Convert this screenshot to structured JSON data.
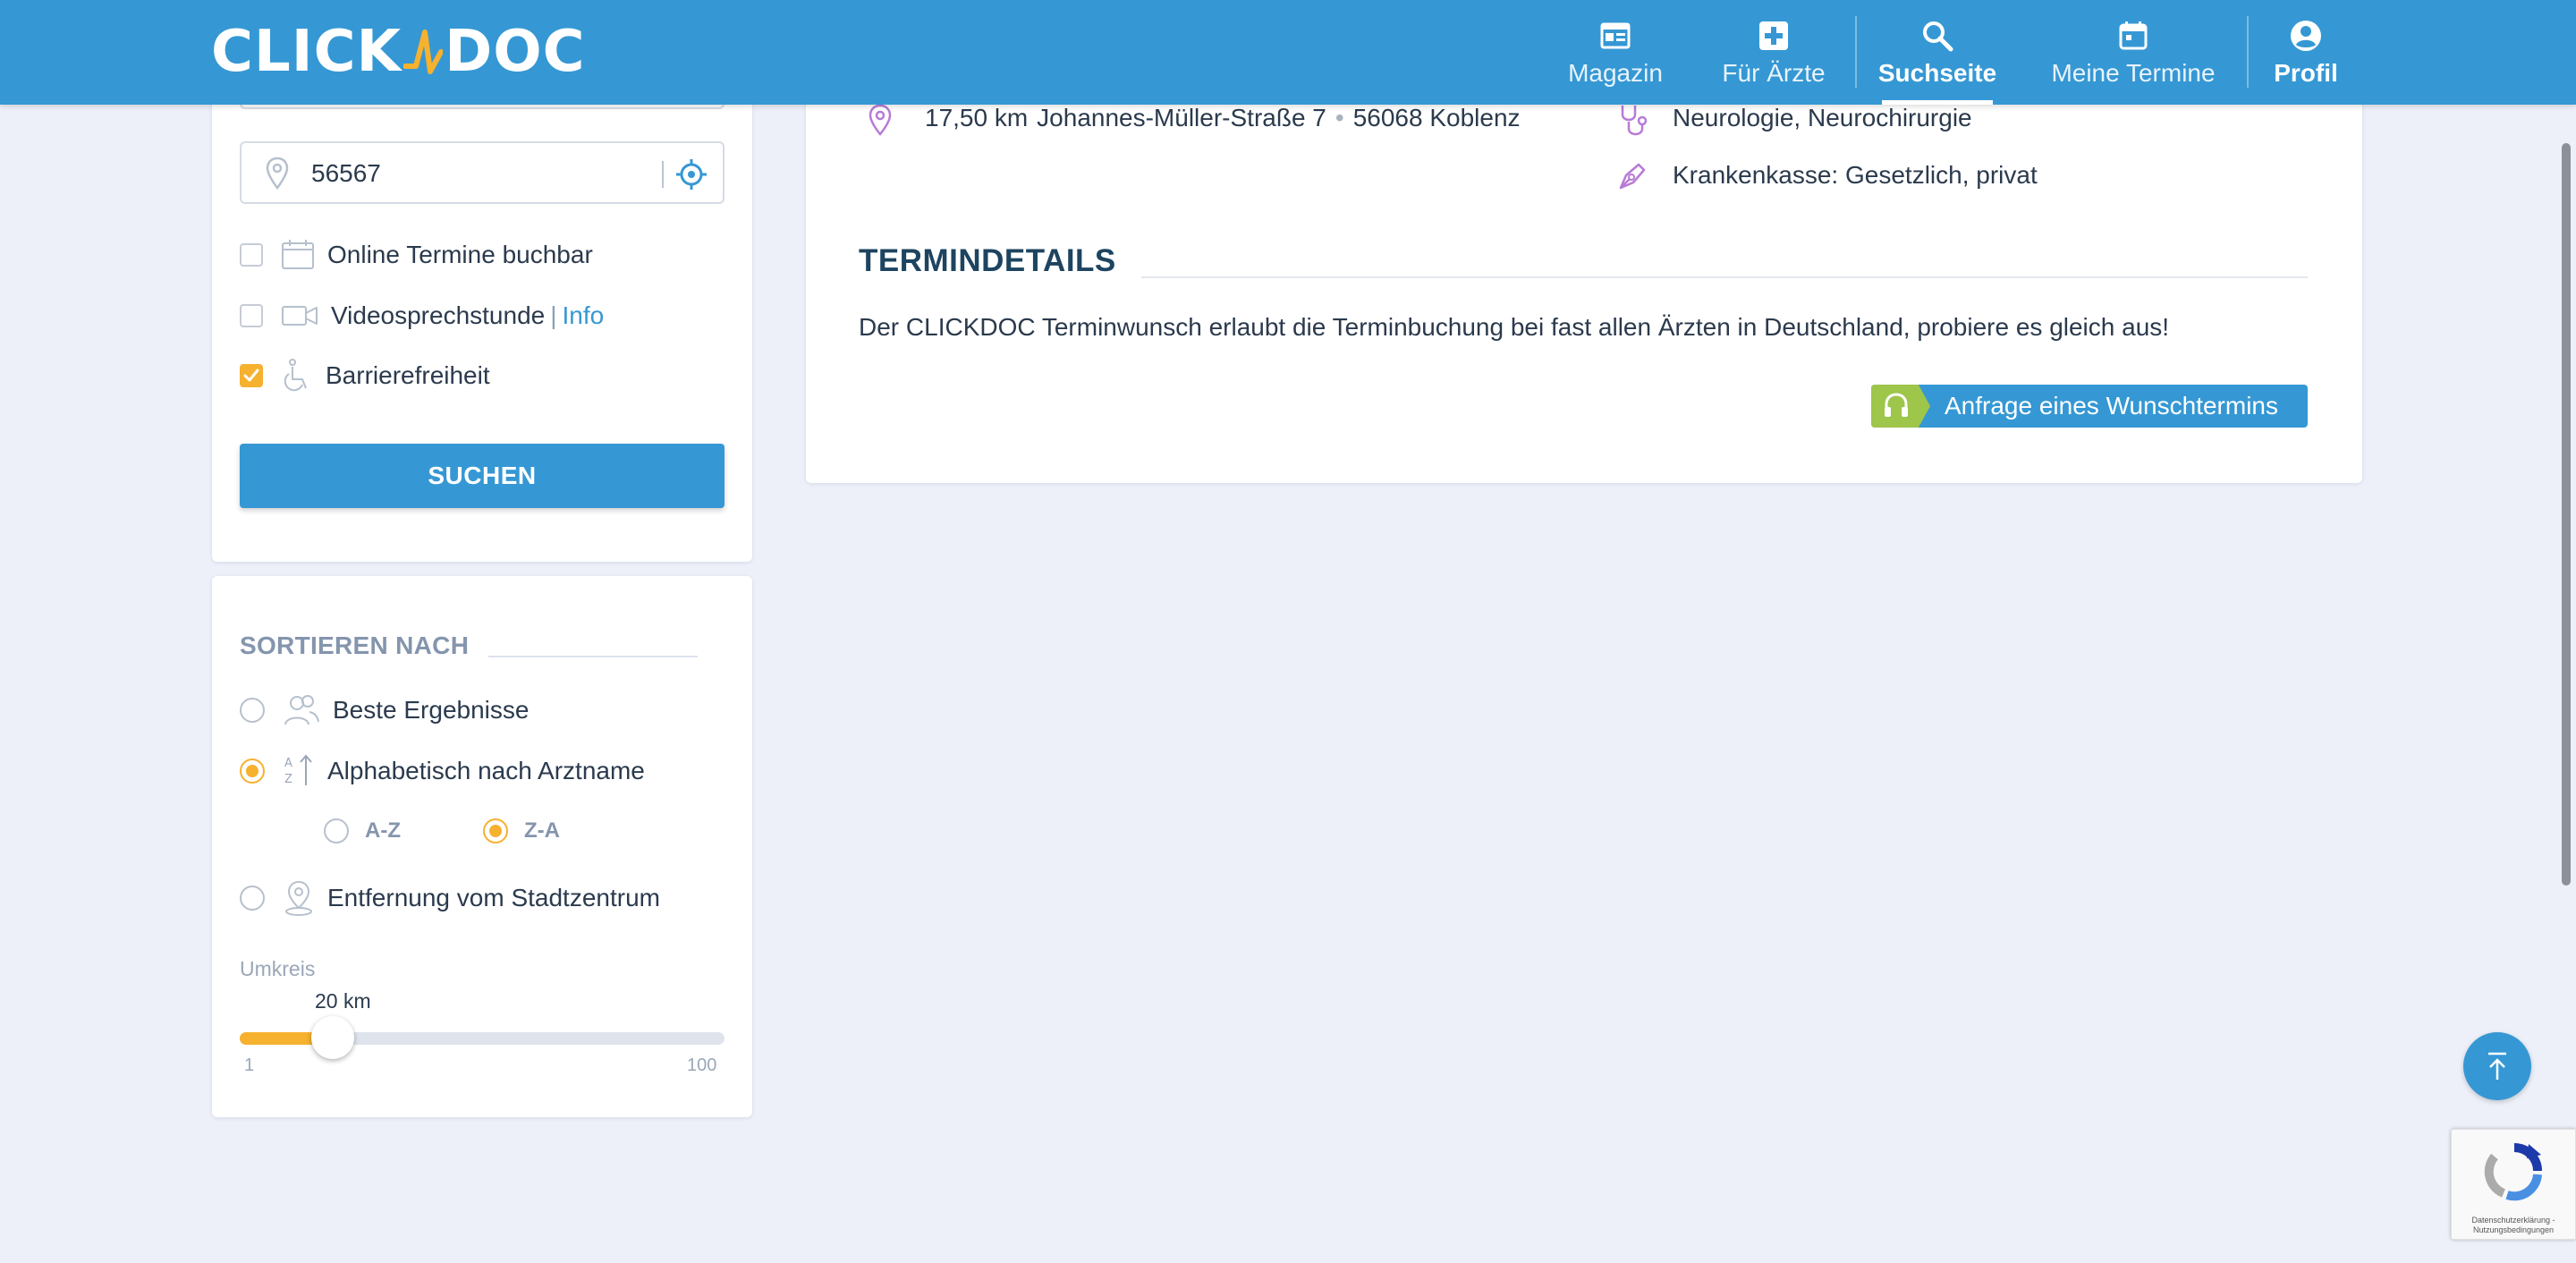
{
  "header": {
    "logo": {
      "left": "CLICK",
      "right": "DOC"
    },
    "nav": [
      {
        "label": "Magazin",
        "icon": "magazine-icon"
      },
      {
        "label": "Für Ärzte",
        "icon": "medical-cross-icon"
      },
      {
        "label": "Suchseite",
        "icon": "search-icon",
        "active": true
      },
      {
        "label": "Meine Termine",
        "icon": "calendar-icon"
      },
      {
        "label": "Profil",
        "icon": "account-icon"
      }
    ]
  },
  "search": {
    "plz_value": "56567",
    "filters": {
      "online": {
        "label": "Online Termine buchbar",
        "checked": false
      },
      "video": {
        "label": "Videosprechstunde",
        "sep": "|",
        "info": "Info",
        "checked": false
      },
      "barrier": {
        "label": "Barrierefreiheit",
        "checked": true
      }
    },
    "button": "SUCHEN"
  },
  "sort": {
    "title": "SORTIEREN NACH",
    "options": {
      "best": "Beste Ergebnisse",
      "alpha": "Alphabetisch nach Arztname",
      "distance": "Entfernung vom Stadtzentrum"
    },
    "selected": "alpha",
    "alpha_order": {
      "az": "A-Z",
      "za": "Z-A",
      "selected": "za"
    },
    "umkreis": {
      "label": "Umkreis",
      "value_text": "20 km",
      "value": 20,
      "min": "1",
      "max": "100"
    }
  },
  "result": {
    "distance": "17,50 km",
    "address": "Johannes-Müller-Straße 7",
    "dot": "•",
    "city": "56068 Koblenz",
    "specialty": "Neurologie, Neurochirurgie",
    "insurance": "Krankenkasse: Gesetzlich, privat",
    "termindetails_title": "TERMINDETAILS",
    "termindetails_text": "Der CLICKDOC Terminwunsch erlaubt die Terminbuchung bei fast allen Ärzten in Deutschland, probiere es gleich aus!",
    "wunsch_button": "Anfrage eines Wunschtermins"
  },
  "recaptcha": {
    "line1": "Datenschutzerklärung -",
    "line2": "Nutzungsbedingungen"
  },
  "colors": {
    "primary": "#3598d4",
    "accent": "#f6b12f",
    "green": "#9ec64a",
    "background": "#edf0f9"
  }
}
